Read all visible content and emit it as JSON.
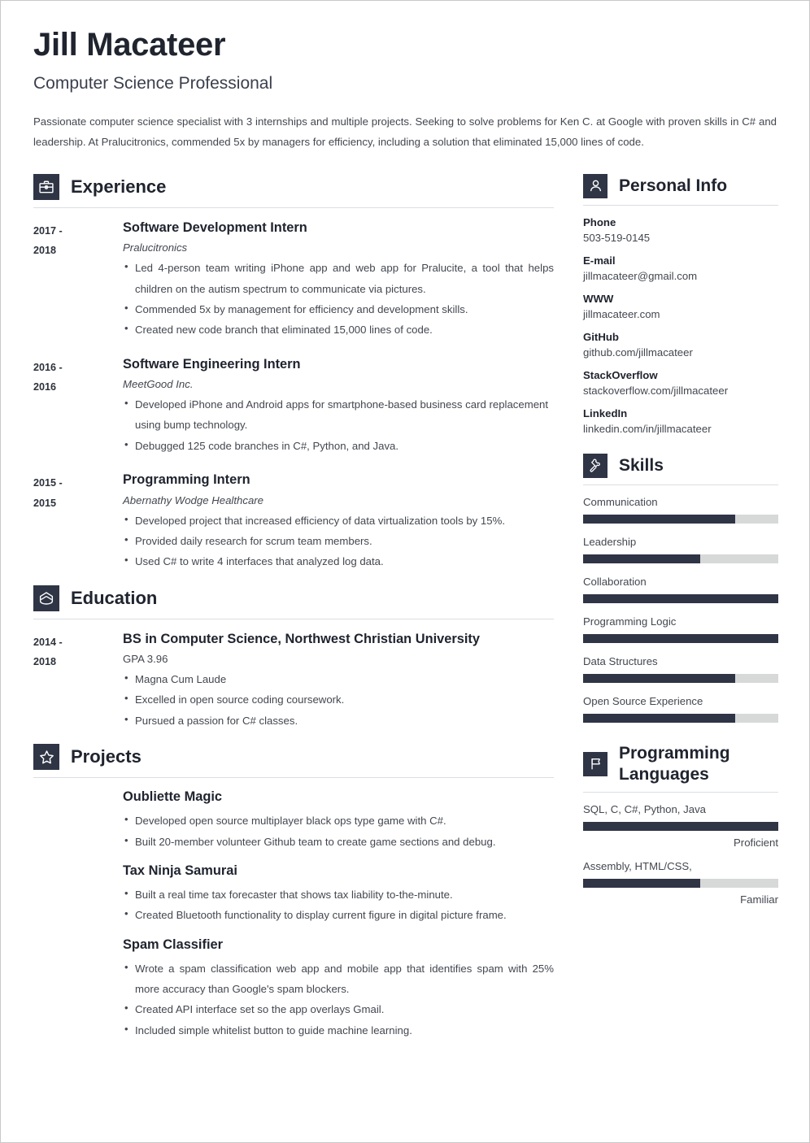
{
  "theme": {
    "accent_dark": "#2f3545",
    "text_dark": "#20242f",
    "text_body": "#43474f",
    "bar_track": "#d7d8d8",
    "rule": "#dcdee2"
  },
  "header": {
    "name": "Jill Macateer",
    "job_title": "Computer Science Professional",
    "summary": "Passionate computer science specialist with 3 internships and multiple projects. Seeking to solve problems for Ken C. at Google with proven skills in C# and leadership. At Pralucitronics, commended 5x by managers for efficiency, including a solution that eliminated 15,000 lines of code."
  },
  "sections": {
    "experience": {
      "title": "Experience",
      "icon": "briefcase-icon",
      "entries": [
        {
          "dates": "2017 - 2018",
          "date_line_1": "2017 -",
          "date_line_2": "2018",
          "title": "Software Development Intern",
          "company": "Pralucitronics",
          "bullets": [
            "Led 4-person team writing iPhone app and web app for Pralucite, a tool that helps children on the autism spectrum to communicate via pictures.",
            "Commended 5x by management for efficiency and development skills.",
            "Created new code branch that eliminated 15,000 lines of code."
          ]
        },
        {
          "dates": "2016 - 2016",
          "date_line_1": "2016 -",
          "date_line_2": "2016",
          "title": "Software Engineering Intern",
          "company": "MeetGood Inc.",
          "bullets": [
            "Developed iPhone and Android apps for smartphone-based business card replacement using bump technology.",
            "Debugged 125 code branches in C#, Python, and Java."
          ]
        },
        {
          "dates": "2015 - 2015",
          "date_line_1": "2015 -",
          "date_line_2": "2015",
          "title": "Programming Intern",
          "company": "Abernathy Wodge Healthcare",
          "bullets": [
            "Developed project that increased efficiency of data virtualization tools by 15%.",
            "Provided daily research for scrum team members.",
            "Used C# to write 4 interfaces that analyzed log data."
          ]
        }
      ]
    },
    "education": {
      "title": "Education",
      "icon": "graduation-cap-icon",
      "entries": [
        {
          "dates": "2014 - 2018",
          "date_line_1": "2014 -",
          "date_line_2": "2018",
          "title": "BS in Computer Science, Northwest Christian University",
          "detail": "GPA 3.96",
          "bullets": [
            "Magna Cum Laude",
            "Excelled in open source coding coursework.",
            "Pursued a passion for C# classes."
          ]
        }
      ]
    },
    "projects": {
      "title": "Projects",
      "icon": "star-icon",
      "items": [
        {
          "title": "Oubliette Magic",
          "bullets": [
            "Developed open source multiplayer black ops type game with C#.",
            "Built 20-member volunteer Github team to create game sections and debug."
          ]
        },
        {
          "title": "Tax Ninja Samurai",
          "bullets": [
            "Built a real time tax forecaster that shows tax liability to-the-minute.",
            "Created Bluetooth functionality to display current figure in digital picture frame."
          ]
        },
        {
          "title": "Spam Classifier",
          "bullets": [
            "Wrote a spam classification web app and mobile app that identifies spam with 25% more accuracy than Google's spam blockers.",
            "Created API interface set so the app overlays Gmail.",
            "Included simple whitelist button to guide machine learning."
          ]
        }
      ]
    },
    "personal_info": {
      "title": "Personal Info",
      "icon": "person-icon",
      "items": [
        {
          "label": "Phone",
          "value": "503-519-0145"
        },
        {
          "label": "E-mail",
          "value": "jillmacateer@gmail.com"
        },
        {
          "label": "WWW",
          "value": "jillmacateer.com"
        },
        {
          "label": "GitHub",
          "value": "github.com/jillmacateer"
        },
        {
          "label": "StackOverflow",
          "value": "stackoverflow.com/jillmacateer"
        },
        {
          "label": "LinkedIn",
          "value": "linkedin.com/in/jillmacateer"
        }
      ]
    },
    "skills": {
      "title": "Skills",
      "icon": "puzzle-icon",
      "items": [
        {
          "name": "Communication",
          "level": 78
        },
        {
          "name": "Leadership",
          "level": 60
        },
        {
          "name": "Collaboration",
          "level": 100
        },
        {
          "name": "Programming Logic",
          "level": 100
        },
        {
          "name": "Data Structures",
          "level": 78
        },
        {
          "name": "Open Source Experience",
          "level": 78
        }
      ]
    },
    "programming_languages": {
      "title": "Programming Languages",
      "icon": "flag-icon",
      "groups": [
        {
          "languages": "SQL, C, C#,  Python, Java",
          "level": 100,
          "level_label": "Proficient"
        },
        {
          "languages": "Assembly, HTML/CSS,",
          "level": 60,
          "level_label": "Familiar"
        }
      ]
    }
  }
}
